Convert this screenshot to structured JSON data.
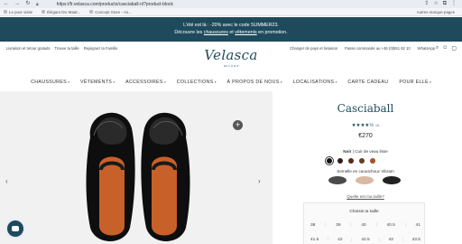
{
  "browser": {
    "url": "https://fr.velasca.com/products/casciaball-nl?product-block",
    "bookmarks": [
      "Le pour visite",
      "Élégant DU Maat...",
      "Concept Store - As..."
    ],
    "bookmarks_right": "Autres marque-pages"
  },
  "promo": {
    "line1": "L'été est là : -20% avec le code SUMMER23.",
    "line2_prefix": "Découvre les ",
    "line2_link1": "chaussures",
    "line2_mid": " et ",
    "line2_link2": "vêtements",
    "line2_suffix": " en promotion."
  },
  "utility": {
    "left": [
      "Livraison et retour gratuits",
      "Trouve ta taille",
      "Rejoignez la Famille"
    ],
    "right": [
      "Changer de pays et livraison",
      "Passe commande au +46 (0)551 62 10",
      "WhatsApp"
    ]
  },
  "logo": {
    "text": "Velasca",
    "sub": "MILANO"
  },
  "nav": [
    {
      "label": "CHAUSSURES",
      "chevron": true
    },
    {
      "label": "VÊTEMENTS",
      "chevron": true
    },
    {
      "label": "ACCESSOIRES",
      "chevron": true
    },
    {
      "label": "COLLECTIONS",
      "chevron": true
    },
    {
      "label": "À PROPOS DE NOUS",
      "chevron": true
    },
    {
      "label": "LOCALISATIONS",
      "chevron": true
    },
    {
      "label": "CARTE CADEAU",
      "chevron": false
    },
    {
      "label": "POUR ELLE",
      "chevron": true
    }
  ],
  "product": {
    "title": "Casciaball",
    "stars": "★★★★½",
    "review_count": "18",
    "price": "€270",
    "color_name": "Noir",
    "color_material": "| Cuir de veau lisse",
    "swatch_colors": [
      "#111111",
      "#2a2018",
      "#5a2a1a",
      "#6b3a22",
      "#a5502a"
    ],
    "sole_label": "Semelle en caoutchouc Vibram",
    "sole_colors": [
      "#4a4a4a",
      "#d9b9a2",
      "#222222"
    ],
    "size_link": "Quelle est ma taille?",
    "size_title": "Choisis ta taille",
    "sizes_row1": [
      "38",
      "39",
      "40",
      "40.5",
      "41"
    ],
    "sizes_row2": [
      "41.5",
      "42",
      "42.5",
      "43",
      "43.5"
    ]
  },
  "colors": {
    "brand": "#1e4a5c",
    "image_bg": "#f1f1f1"
  }
}
